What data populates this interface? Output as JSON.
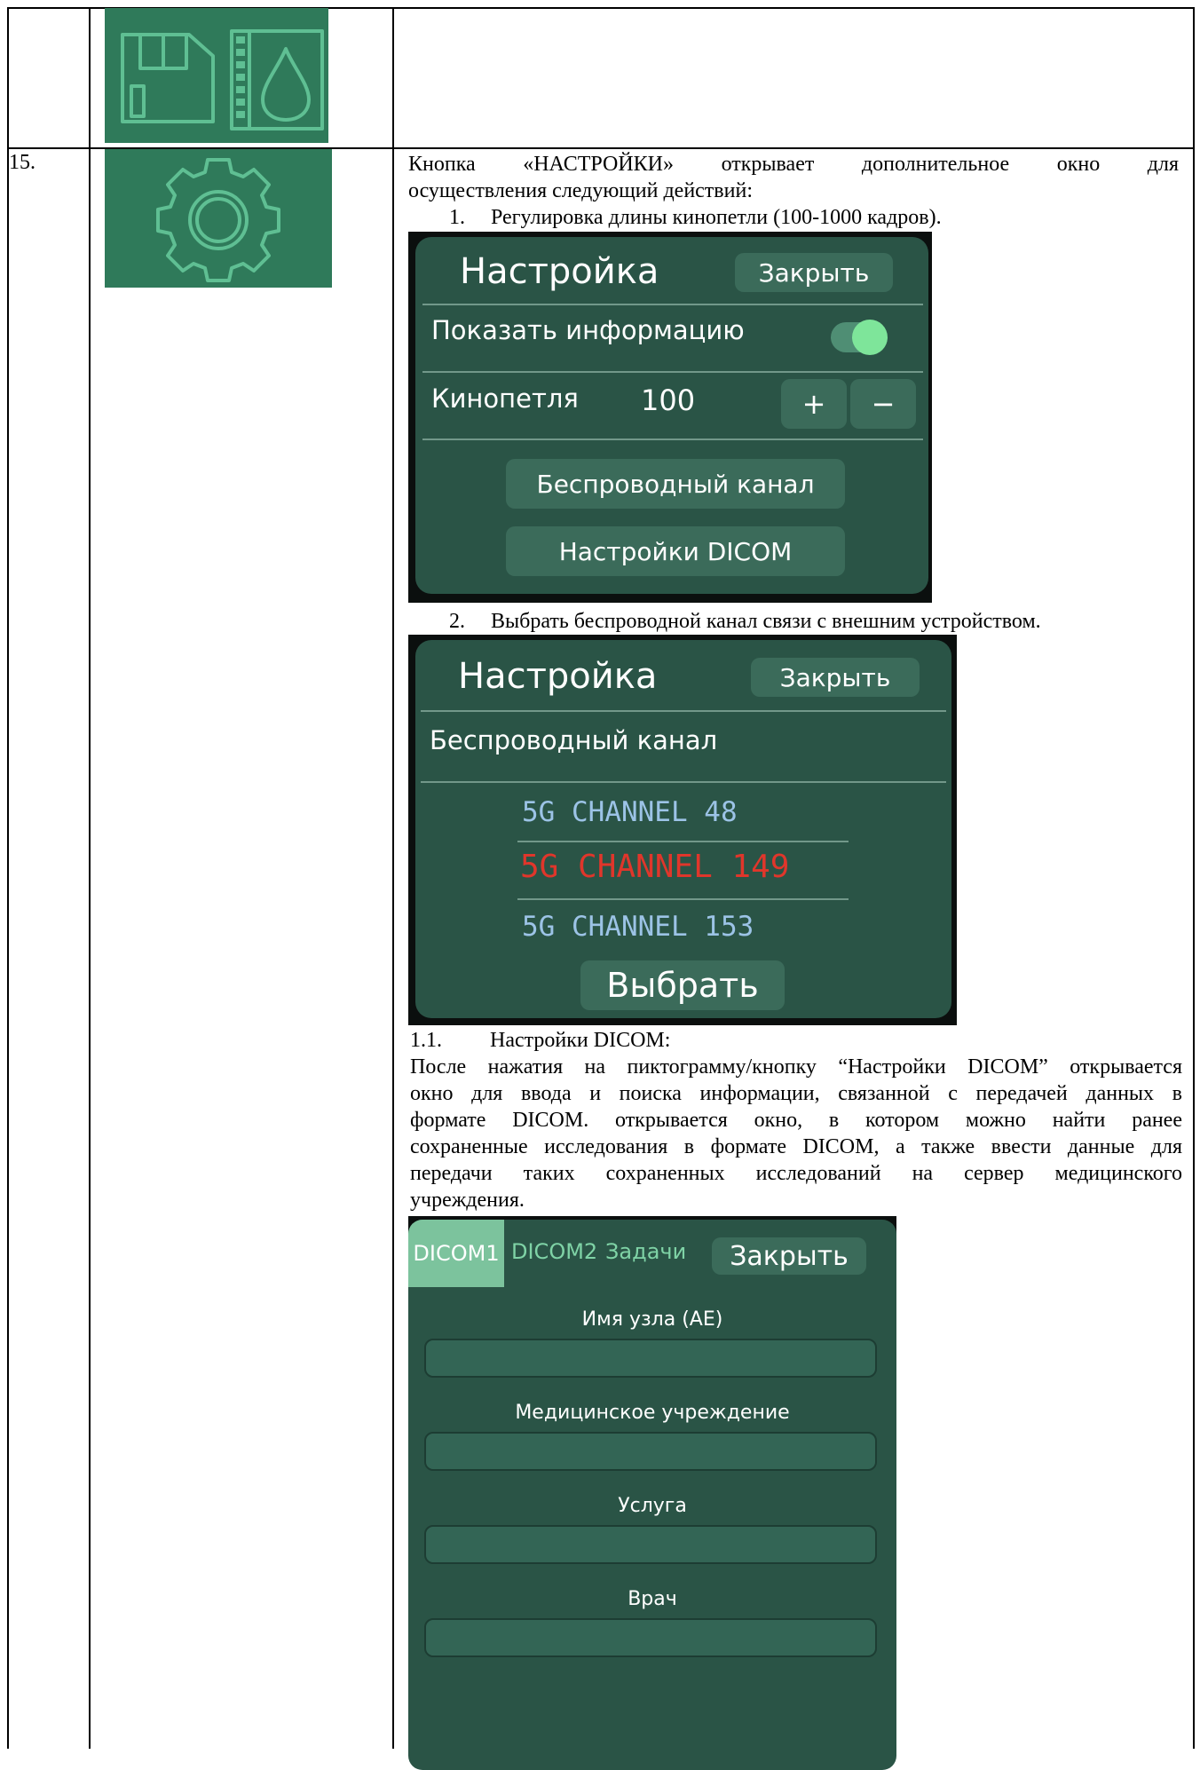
{
  "row_number": "15.",
  "intro_line1_words": [
    "Кнопка",
    "«НАСТРОЙКИ»",
    "открывает",
    "дополнительное",
    "окно",
    "для"
  ],
  "intro_line2": "осуществления следующий действий:",
  "step1": {
    "num": "1.",
    "text": "Регулировка длины кинопетли (100-1000 кадров)."
  },
  "settings_panel": {
    "title": "Настройка",
    "close": "Закрыть",
    "show_info": "Показать информацию",
    "show_info_on": true,
    "cineloop_label": "Кинопетля",
    "cineloop_value": "100",
    "plus": "+",
    "minus": "−",
    "wireless": "Беспроводный канал",
    "dicom": "Настройки DICOM"
  },
  "step2": {
    "num": "2.",
    "text": "Выбрать беспроводной канал связи с внешним устройством."
  },
  "wireless_panel": {
    "title": "Настройка",
    "close": "Закрыть",
    "heading": "Беспроводный канал",
    "channels": [
      {
        "label": "5G CHANNEL 48",
        "selected": false
      },
      {
        "label": "5G CHANNEL 149",
        "selected": true
      },
      {
        "label": "5G CHANNEL 153",
        "selected": false
      }
    ],
    "select": "Выбрать"
  },
  "step11": {
    "num": "1.1.",
    "text": "Настройки DICOM:"
  },
  "dicom_paragraph": [
    "После нажатия на пиктограмму/кнопку “Настройки DICOM” открывается",
    "окно для ввода и поиска информации, связанной с передачей данных в",
    "формате DICOM. открывается окно, в котором можно найти ранее",
    "сохраненные исследования в формате DICOM, а также ввести данные для",
    "передачи таких сохраненных исследований на сервер медицинского"
  ],
  "dicom_paragraph_last": "учреждения.",
  "dicom_panel": {
    "tabs": [
      "DICOM1",
      "DICOM2",
      "Задачи"
    ],
    "close": "Закрыть",
    "fields": [
      {
        "label": "Имя узла (AE)",
        "value": ""
      },
      {
        "label": "Медицинское учреждение",
        "value": ""
      },
      {
        "label": "Услуга",
        "value": ""
      },
      {
        "label": "Врач",
        "value": ""
      }
    ]
  },
  "colors": {
    "panel_bg": "#2a5446",
    "button_bg": "#3b6b5a",
    "toggle_on": "#7ee59a",
    "channel_normal": "#9cc3e6",
    "channel_selected": "#e0362b",
    "tab_active": "#7cc39d",
    "tab_inactive_text": "#7fd3a6"
  },
  "icons": [
    "save-to-film-icon",
    "gear-icon"
  ]
}
